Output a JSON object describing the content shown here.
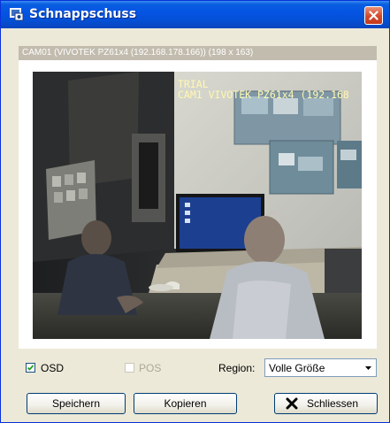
{
  "window": {
    "title": "Schnappschuss",
    "close_icon": "close-icon",
    "app_icon": "camera-snapshot-icon"
  },
  "camera": {
    "header": "CAM01 (VIVOTEK PZ61x4 (192.168.178.166)) (198 x 163)",
    "osd_line1": "TRIAL",
    "osd_line2": "CAM1 VIVOTEK PZ61x4 (192.168"
  },
  "options": {
    "osd_label": "OSD",
    "osd_checked": true,
    "pos_label": "POS",
    "pos_checked": false,
    "pos_enabled": false,
    "region_label": "Region:",
    "region_value": "Volle Größe"
  },
  "buttons": {
    "save": "Speichern",
    "copy": "Kopieren",
    "close": "Schliessen",
    "close_icon": "x-icon"
  },
  "colors": {
    "titlebar": "#0554e3",
    "close_button": "#d1492b",
    "header_bar": "#c2bcae",
    "osd_text": "#fff8b0"
  }
}
